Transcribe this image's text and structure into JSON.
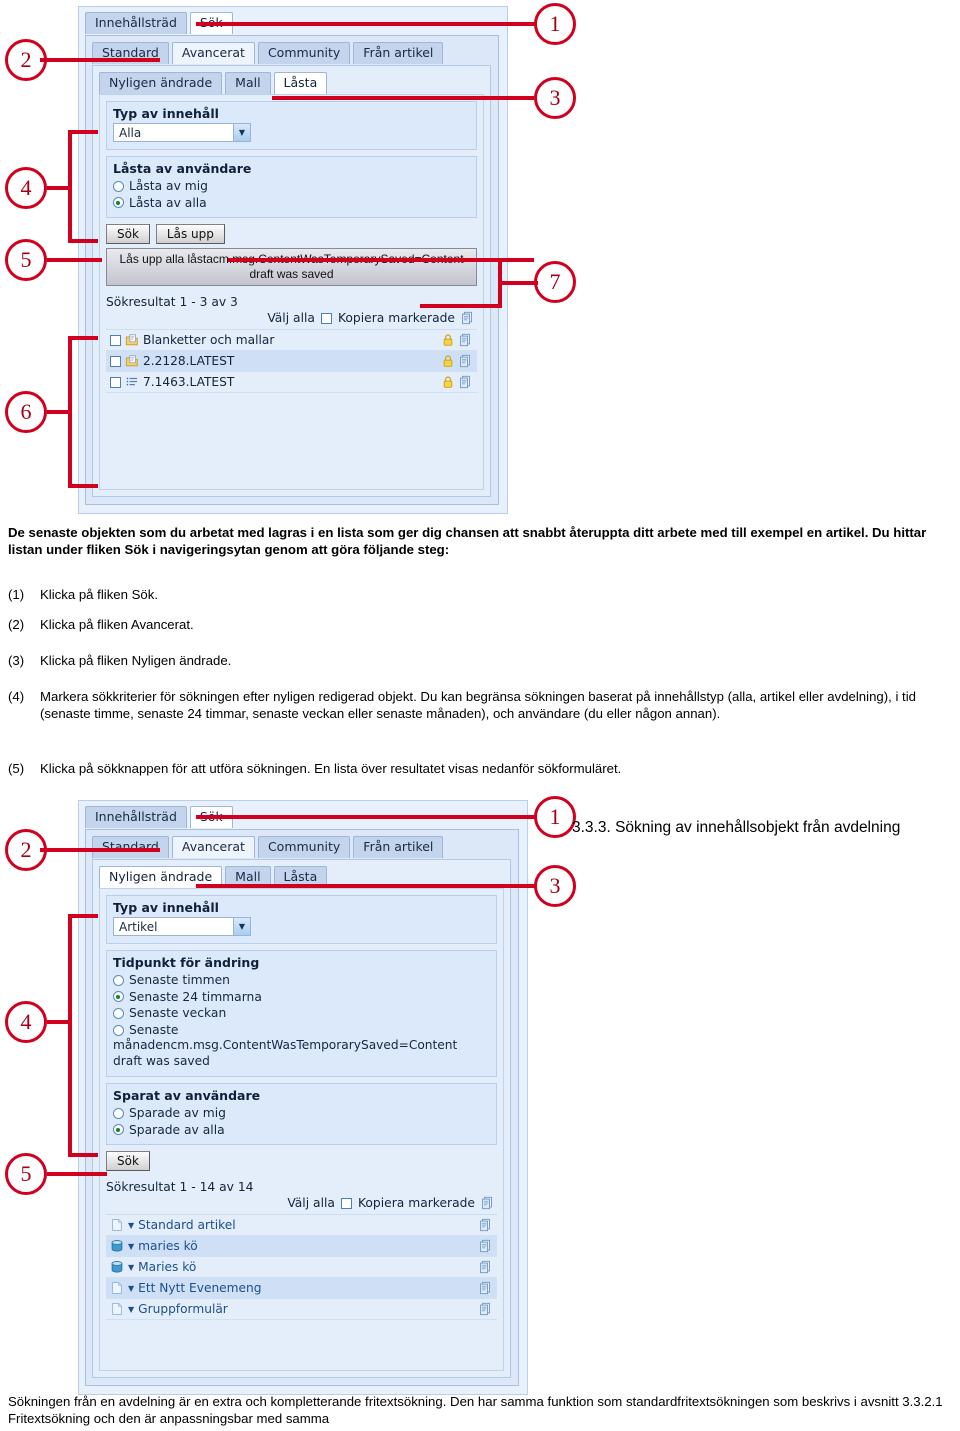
{
  "colors": {
    "callout": "#d1001f",
    "panel": "#dce7f7",
    "field": "#dbe9fb",
    "link": "#1c4f8f",
    "lock": "#f2c438"
  },
  "screenshot1": {
    "outer_tabs": [
      {
        "label": "Innehållsträd",
        "active": false
      },
      {
        "label": "Sök",
        "active": true
      }
    ],
    "mid_tabs": [
      {
        "label": "Standard",
        "active": false
      },
      {
        "label": "Avancerat",
        "active": true
      },
      {
        "label": "Community",
        "active": false
      },
      {
        "label": "Från artikel",
        "active": false
      }
    ],
    "inner_tabs": [
      {
        "label": "Nyligen ändrade",
        "active": false
      },
      {
        "label": "Mall",
        "active": false
      },
      {
        "label": "Låsta",
        "active": true
      }
    ],
    "content_type": {
      "legend": "Typ av innehåll",
      "value": "Alla"
    },
    "locked_by": {
      "legend": "Låsta av användare",
      "options": [
        {
          "label": "Låsta av mig",
          "selected": false
        },
        {
          "label": "Låsta av alla",
          "selected": true
        }
      ]
    },
    "buttons": {
      "search": "Sök",
      "unlock": "Lås upp",
      "unlock_all": "Lås upp alla låstacm.msg.ContentWasTemporarySaved=Content draft was saved"
    },
    "results": {
      "summary": "Sökresultat 1 - 3 av 3",
      "select_all_label": "Välj alla",
      "copy_selected_label": "Kopiera markerade",
      "rows": [
        {
          "name": "Blanketter och mallar",
          "icon": "folder-page-icon",
          "locked": true
        },
        {
          "name": "2.2128.LATEST",
          "icon": "folder-page-icon",
          "locked": true
        },
        {
          "name": "7.1463.LATEST",
          "icon": "list-icon",
          "locked": true
        }
      ]
    },
    "callouts": [
      "1",
      "2",
      "3",
      "4",
      "5",
      "6",
      "7"
    ]
  },
  "body_text": {
    "intro": "De senaste objekten som du arbetat med lagras i en lista som ger dig chansen att snabbt återuppta ditt arbete med till exempel en artikel. Du hittar listan under fliken Sök i navigeringsytan genom att göra följande steg:",
    "steps": [
      {
        "n": "(1)",
        "text": "Klicka på fliken Sök."
      },
      {
        "n": "(2)",
        "text": "Klicka på fliken Avancerat."
      },
      {
        "n": "(3)",
        "text": "Klicka på fliken Nyligen ändrade."
      },
      {
        "n": "(4)",
        "text": "Markera sökkriterier för sökningen efter nyligen redigerad objekt. Du kan begränsa sökningen baserat på innehållstyp (alla, artikel eller avdelning), i tid (senaste timme, senaste 24 timmar, senaste veckan eller senaste månaden), och användare (du eller någon annan)."
      },
      {
        "n": "(5)",
        "text": "Klicka på sökknappen för att utföra sökningen. En lista över resultatet visas nedanför sökformuläret."
      }
    ]
  },
  "section_heading": "3.3.3. Sökning av innehållsobjekt från avdelning",
  "screenshot2": {
    "outer_tabs": [
      {
        "label": "Innehållsträd",
        "active": false
      },
      {
        "label": "Sök",
        "active": true
      }
    ],
    "mid_tabs": [
      {
        "label": "Standard",
        "active": false
      },
      {
        "label": "Avancerat",
        "active": true
      },
      {
        "label": "Community",
        "active": false
      },
      {
        "label": "Från artikel",
        "active": false
      }
    ],
    "inner_tabs": [
      {
        "label": "Nyligen ändrade",
        "active": true
      },
      {
        "label": "Mall",
        "active": false
      },
      {
        "label": "Låsta",
        "active": false
      }
    ],
    "content_type": {
      "legend": "Typ av innehåll",
      "value": "Artikel"
    },
    "change_time": {
      "legend": "Tidpunkt för ändring",
      "options": [
        {
          "label": "Senaste timmen",
          "selected": false
        },
        {
          "label": "Senaste 24 timmarna",
          "selected": true
        },
        {
          "label": "Senaste veckan",
          "selected": false
        },
        {
          "label": "Senaste",
          "selected": false
        }
      ],
      "overflow_text": "månadencm.msg.ContentWasTemporarySaved=Content draft was saved"
    },
    "saved_by": {
      "legend": "Sparat av användare",
      "options": [
        {
          "label": "Sparade av mig",
          "selected": false
        },
        {
          "label": "Sparade av alla",
          "selected": true
        }
      ]
    },
    "buttons": {
      "search": "Sök"
    },
    "results": {
      "summary": "Sökresultat 1 - 14 av 14",
      "select_all_label": "Välj alla",
      "copy_selected_label": "Kopiera markerade",
      "rows": [
        {
          "name": "Standard artikel",
          "icon": "page-icon"
        },
        {
          "name": "maries kö",
          "icon": "database-icon"
        },
        {
          "name": "Maries kö",
          "icon": "database-icon"
        },
        {
          "name": "Ett Nytt Evenemeng",
          "icon": "page-icon"
        },
        {
          "name": "Gruppformulär",
          "icon": "page-icon"
        }
      ]
    },
    "callouts": [
      "1",
      "2",
      "3",
      "4",
      "5"
    ]
  },
  "footer_text": "Sökningen från en avdelning är en extra och kompletterande fritextsökning. Den har samma funktion som standardfritextsökningen som beskrivs i avsnitt 3.3.2.1 Fritextsökning och den är anpassningsbar med samma"
}
